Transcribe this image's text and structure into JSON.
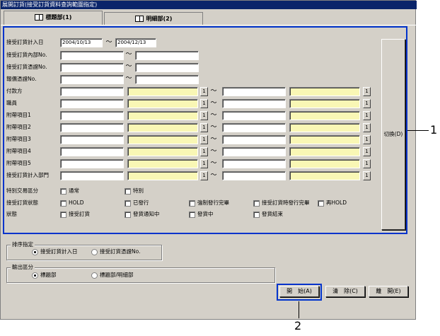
{
  "window": {
    "title": "展開訂貨(接受訂貨資料查詢範圍指定)"
  },
  "tabs": [
    {
      "label": "標題部(1)",
      "active": true,
      "icon": "book-icon"
    },
    {
      "label": "明細部(2)",
      "active": false,
      "icon": "book-icon"
    }
  ],
  "form": {
    "date_label": "接受訂貨計入日",
    "date_from": "2004/10/13",
    "date_to": "2004/12/13",
    "range_labels": [
      "接受訂貨內部No.",
      "接受訂貨憑證No.",
      "報價憑證No."
    ],
    "code_labels": [
      "付款方",
      "職員",
      "附帶項目1",
      "附帶項目2",
      "附帶項目3",
      "附帶項目4",
      "附帶項目5",
      "接受訂貨計入部門"
    ],
    "tilde": "～",
    "lookup_button": "1"
  },
  "special": {
    "label": "特別交易區分",
    "options": [
      "通常",
      "特別"
    ]
  },
  "status": {
    "label1": "接受訂貨狀態",
    "label2": "狀態",
    "row1": [
      "HOLD",
      "已發行",
      "強制發行完畢",
      "接受訂貨時發行完畢",
      "再HOLD"
    ],
    "row2": [
      "接受訂貨",
      "發貨通知中",
      "發貨中",
      "發貨結束"
    ]
  },
  "switch_button": "切換(D)",
  "sort": {
    "label": "排序指定",
    "options": [
      "接受訂貨計入日",
      "接受訂貨憑證No."
    ],
    "selected": 0
  },
  "output": {
    "label": "輸出區分",
    "options": [
      "標題部",
      "標題部/明細部"
    ],
    "selected": 0
  },
  "buttons": {
    "start": "開　始(A)",
    "clear": "清　除(C)",
    "exit": "離　開(E)"
  },
  "callouts": [
    "1",
    "2"
  ]
}
